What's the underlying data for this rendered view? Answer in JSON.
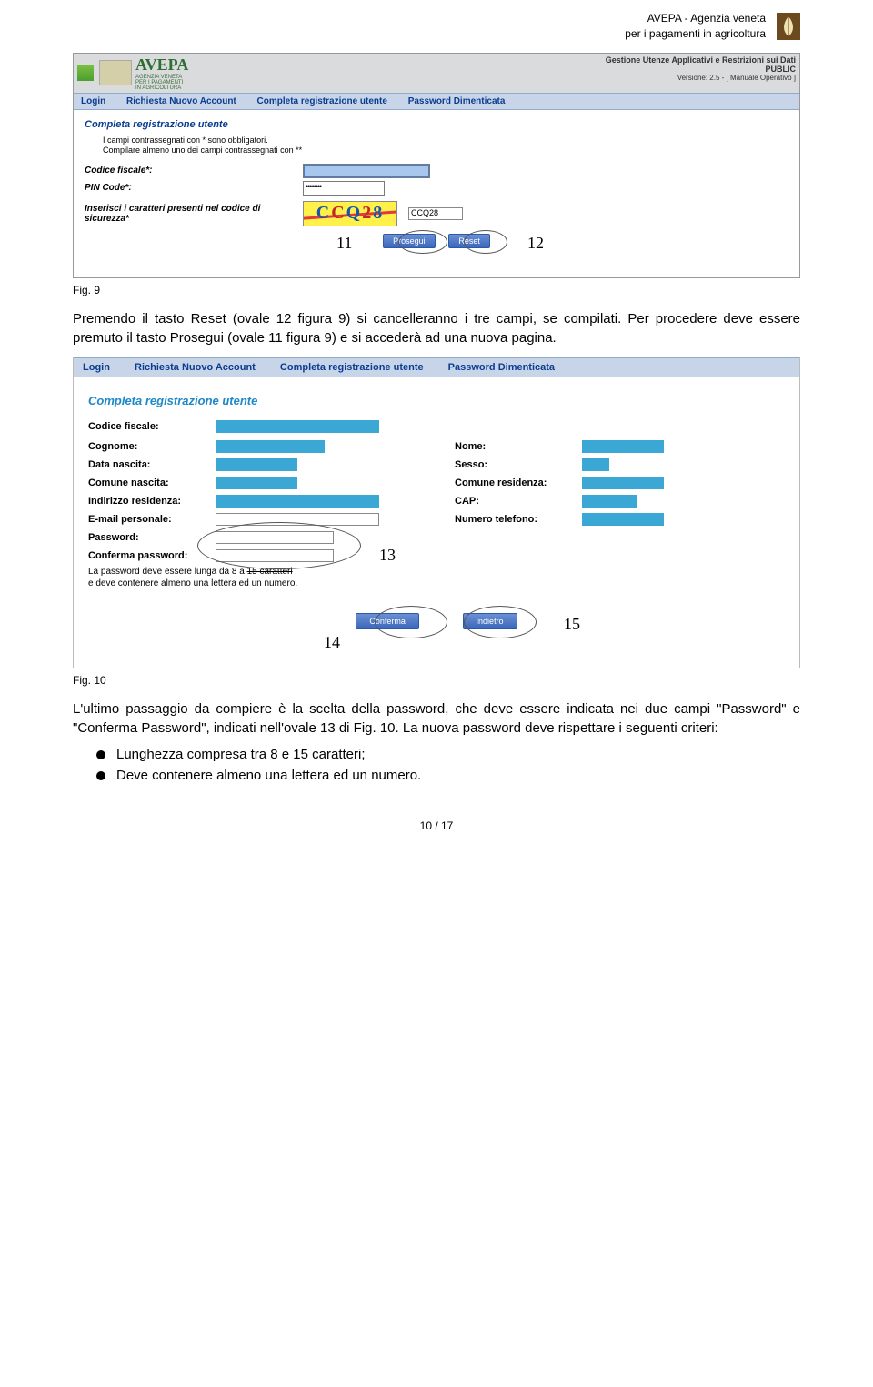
{
  "header": {
    "org_line1": "AVEPA - Agenzia veneta",
    "org_line2": "per i pagamenti in agricoltura"
  },
  "screenshot1": {
    "top_right": {
      "line1": "Gestione Utenze Applicativi e Restrizioni sui Dati",
      "line2": "PUBLIC",
      "line3": "Versione: 2.5 - [ Manuale Operativo ]"
    },
    "logo_text": "AVEPA",
    "logo_sub1": "AGENZIA VENETA",
    "logo_sub2": "PER I PAGAMENTI",
    "logo_sub3": "IN AGRICOLTURA",
    "menu": {
      "login": "Login",
      "richiesta": "Richiesta Nuovo Account",
      "completa": "Completa registrazione utente",
      "password": "Password Dimenticata"
    },
    "section_title": "Completa registrazione utente",
    "hint1": "I campi contrassegnati con * sono obbligatori.",
    "hint2": "Compilare almeno uno dei campi contrassegnati con **",
    "labels": {
      "cf": "Codice fiscale*:",
      "pin": "PIN Code*:",
      "captcha": "Inserisci i caratteri presenti nel codice di sicurezza*"
    },
    "pin_value": "••••••••",
    "captcha_letters": [
      "C",
      "C",
      "Q",
      "2",
      "8"
    ],
    "captcha_input": "CCQ28",
    "btn_prosegui": "Prosegui",
    "btn_reset": "Reset",
    "annot_left": "11",
    "annot_right": "12"
  },
  "caption1": "Fig. 9",
  "para1": "Premendo il tasto Reset (ovale 12 figura 9) si cancelleranno i tre campi, se compilati. Per procedere deve essere premuto il tasto Prosegui (ovale 11 figura 9) e si accederà ad una nuova pagina.",
  "screenshot2": {
    "menu": {
      "login": "Login",
      "richiesta": "Richiesta Nuovo Account",
      "completa": "Completa registrazione utente",
      "password": "Password Dimenticata"
    },
    "title": "Completa registrazione utente",
    "labels": {
      "cf": "Codice fiscale:",
      "cognome": "Cognome:",
      "nome": "Nome:",
      "data_nascita": "Data nascita:",
      "sesso": "Sesso:",
      "comune_nascita": "Comune nascita:",
      "comune_res": "Comune residenza:",
      "indirizzo_res": "Indirizzo residenza:",
      "cap": "CAP:",
      "email": "E-mail personale:",
      "telefono": "Numero telefono:",
      "password": "Password:",
      "conferma": "Conferma password:"
    },
    "pw_hint_a": "La password deve essere lunga da 8 a ",
    "pw_hint_strike": "15 caratteri",
    "pw_hint_b": "e deve contenere almeno una lettera ed un numero.",
    "btn_conferma": "Conferma",
    "btn_indietro": "Indietro",
    "annot13": "13",
    "annot14": "14",
    "annot15": "15"
  },
  "caption2": "Fig. 10",
  "para2": "L'ultimo passaggio da compiere è la scelta della password, che deve essere indicata nei due campi \"Password\" e \"Conferma Password\", indicati nell'ovale 13 di Fig. 10. La nuova password deve rispettare i seguenti criteri:",
  "bullet1": "Lunghezza compresa tra 8 e 15 caratteri;",
  "bullet2": "Deve contenere almeno una lettera ed un numero.",
  "footer": "10 / 17"
}
